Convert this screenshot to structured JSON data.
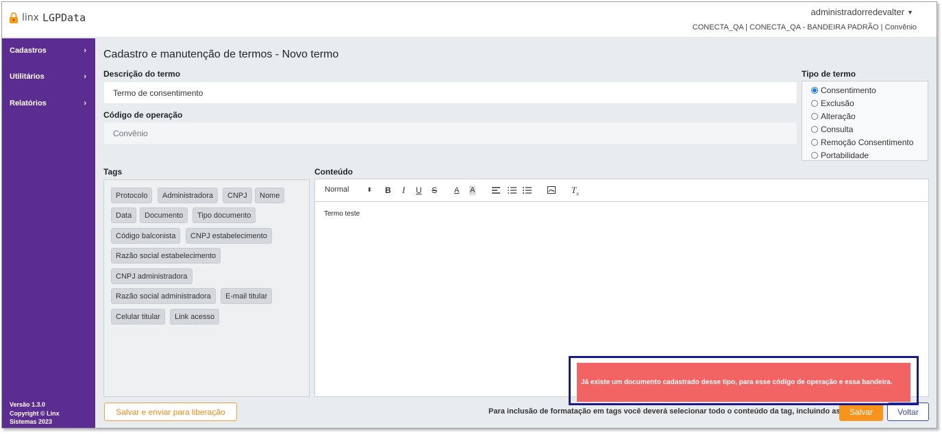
{
  "header": {
    "brand_prefix": "linx",
    "brand_name": "LGPData",
    "user": "administradorredevalter",
    "context": "CONECTA_QA | CONECTA_QA - BANDEIRA PADRÃO | Convênio"
  },
  "sidebar": {
    "items": [
      {
        "label": "Cadastros",
        "arrow": "›"
      },
      {
        "label": "Utilitários",
        "arrow": "›"
      },
      {
        "label": "Relatórios",
        "arrow": "›"
      }
    ],
    "footer": {
      "version": "Versão 1.3.0",
      "copyright": "Copyright © Linx",
      "company_year": "Sistemas 2023"
    }
  },
  "main": {
    "title": "Cadastro e manutenção de termos - Novo termo",
    "descricao_label": "Descrição do termo",
    "descricao_value": "Termo de consentimento",
    "codigo_label": "Código de operação",
    "codigo_value": "Convênio",
    "tipo_label": "Tipo de termo",
    "tipo_options": [
      {
        "label": "Consentimento",
        "selected": true
      },
      {
        "label": "Exclusão",
        "selected": false
      },
      {
        "label": "Alteração",
        "selected": false
      },
      {
        "label": "Consulta",
        "selected": false
      },
      {
        "label": "Remoção Consentimento",
        "selected": false
      },
      {
        "label": "Portabilidade",
        "selected": false
      }
    ],
    "tags_label": "Tags",
    "tags": [
      "Protocolo",
      "Administradora",
      "CNPJ",
      "Nome",
      "Data",
      "Documento",
      "Tipo documento",
      "Código balconista",
      "CNPJ estabelecimento",
      "Razão social estabelecimento",
      "CNPJ administradora",
      "Razão social administradora",
      "E-mail titular",
      "Celular titular",
      "Link acesso"
    ],
    "conteudo_label": "Conteúdo",
    "editor": {
      "format_select": "Normal",
      "body_text": "Termo teste"
    },
    "note": "Para inclusão de formatação em tags você deverá selecionar todo o conteúdo da tag, incluindo as { }",
    "buttons": {
      "save_send": "Salvar e enviar para liberação",
      "save": "Salvar",
      "back": "Voltar"
    }
  },
  "toast": {
    "message": "Já existe um documento cadastrado desse tipo, para esse código de operação e essa bandeira."
  },
  "colors": {
    "sidebar": "#5b2d90",
    "accent_orange": "#f7941d",
    "toast_bg": "#f26464",
    "toast_outline": "#1a1a8c",
    "radio_selected": "#1a73e8"
  }
}
